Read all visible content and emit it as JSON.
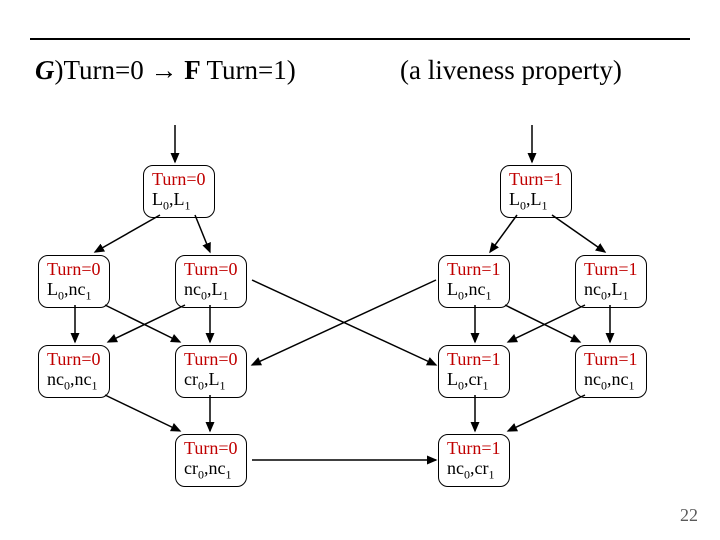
{
  "title": {
    "g": "G",
    "paren": ")",
    "left": "Turn=0 ",
    "arrow": "→",
    "f": " F ",
    "right": "Turn=1)"
  },
  "subtitle": "(a liveness property)",
  "pagenum": "22",
  "nodes": {
    "L_top": {
      "turn": "Turn=0",
      "state": "L",
      "s1": "0",
      "mid": ",L",
      "s2": "1"
    },
    "L_a": {
      "turn": "Turn=0",
      "state": "L",
      "s1": "0",
      "mid": ",nc",
      "s2": "1"
    },
    "L_b": {
      "turn": "Turn=0",
      "state": "nc",
      "s1": "0",
      "mid": ",L",
      "s2": "1"
    },
    "L_c": {
      "turn": "Turn=0",
      "state": "nc",
      "s1": "0",
      "mid": ",nc",
      "s2": "1"
    },
    "L_d": {
      "turn": "Turn=0",
      "state": "cr",
      "s1": "0",
      "mid": ",L",
      "s2": "1"
    },
    "L_bot": {
      "turn": "Turn=0",
      "state": "cr",
      "s1": "0",
      "mid": ",nc",
      "s2": "1"
    },
    "R_top": {
      "turn": "Turn=1",
      "state": "L",
      "s1": "0",
      "mid": ",L",
      "s2": "1"
    },
    "R_a": {
      "turn": "Turn=1",
      "state": "L",
      "s1": "0",
      "mid": ",nc",
      "s2": "1"
    },
    "R_b": {
      "turn": "Turn=1",
      "state": "nc",
      "s1": "0",
      "mid": ",L",
      "s2": "1"
    },
    "R_c": {
      "turn": "Turn=1",
      "state": "L",
      "s1": "0",
      "mid": ",cr",
      "s2": "1"
    },
    "R_d": {
      "turn": "Turn=1",
      "state": "nc",
      "s1": "0",
      "mid": ",nc",
      "s2": "1"
    },
    "R_bot": {
      "turn": "Turn=1",
      "state": "nc",
      "s1": "0",
      "mid": ",cr",
      "s2": "1"
    }
  }
}
